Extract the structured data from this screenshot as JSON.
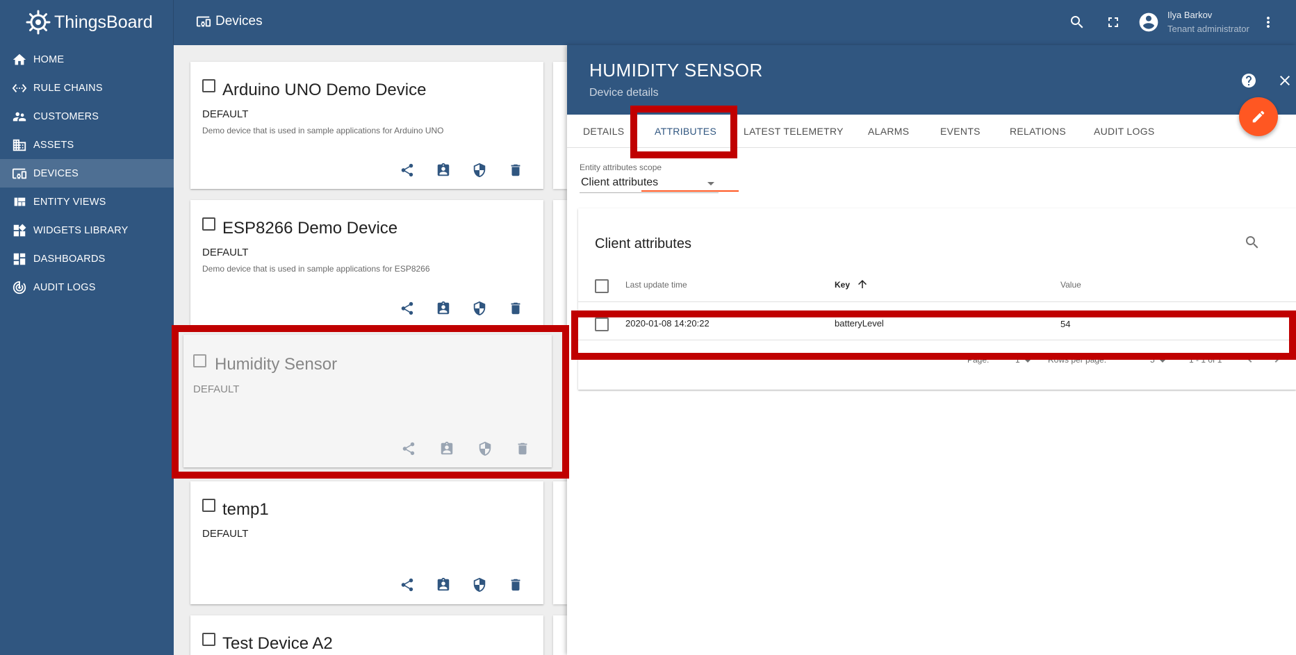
{
  "app": {
    "name": "ThingsBoard",
    "breadcrumb": "Devices"
  },
  "user": {
    "name": "Ilya Barkov",
    "role": "Tenant administrator"
  },
  "colors": {
    "primary": "#305680",
    "accent": "#ff5722",
    "highlight": "#c00000",
    "icon": "#305680"
  },
  "sidebar": {
    "items": [
      {
        "label": "HOME",
        "icon": "home-icon"
      },
      {
        "label": "RULE CHAINS",
        "icon": "settings-ethernet-icon"
      },
      {
        "label": "CUSTOMERS",
        "icon": "supervisor-account-icon"
      },
      {
        "label": "ASSETS",
        "icon": "domain-icon"
      },
      {
        "label": "DEVICES",
        "icon": "devices-other-icon",
        "active": true
      },
      {
        "label": "ENTITY VIEWS",
        "icon": "view-quilt-icon"
      },
      {
        "label": "WIDGETS LIBRARY",
        "icon": "widgets-icon"
      },
      {
        "label": "DASHBOARDS",
        "icon": "dashboards-icon"
      },
      {
        "label": "AUDIT LOGS",
        "icon": "track-changes-icon"
      }
    ]
  },
  "cards": [
    {
      "title": "Arduino UNO Demo Device",
      "type": "DEFAULT",
      "description": "Demo device that is used in sample applications for Arduino UNO"
    },
    {
      "title": "ESP8266 Demo Device",
      "type": "DEFAULT",
      "description": "Demo device that is used in sample applications for ESP8266"
    },
    {
      "title": "Humidity Sensor",
      "type": "DEFAULT",
      "description": ""
    },
    {
      "title": "temp1",
      "type": "DEFAULT",
      "description": ""
    },
    {
      "title": "Test Device A2",
      "type": "",
      "description": ""
    }
  ],
  "card_actions": [
    "share-icon",
    "assign-to-customer-icon",
    "security-icon",
    "delete-icon"
  ],
  "panel": {
    "title": "HUMIDITY SENSOR",
    "subtitle": "Device details",
    "tabs": [
      "DETAILS",
      "ATTRIBUTES",
      "LATEST TELEMETRY",
      "ALARMS",
      "EVENTS",
      "RELATIONS",
      "AUDIT LOGS"
    ],
    "active_tab": "ATTRIBUTES",
    "scope_label": "Entity attributes scope",
    "scope_value": "Client attributes",
    "table": {
      "title": "Client attributes",
      "columns": [
        "Last update time",
        "Key",
        "Value"
      ],
      "sort": {
        "column": "Key",
        "direction": "ascending"
      },
      "rows": [
        {
          "last_update": "2020-01-08 14:20:22",
          "key": "batteryLevel",
          "value": "54"
        }
      ],
      "pagination": {
        "page_label": "Page:",
        "page_value": "1",
        "rows_label": "Rows per page:",
        "rows_value": "5",
        "range": "1 - 1 of 1"
      }
    }
  }
}
